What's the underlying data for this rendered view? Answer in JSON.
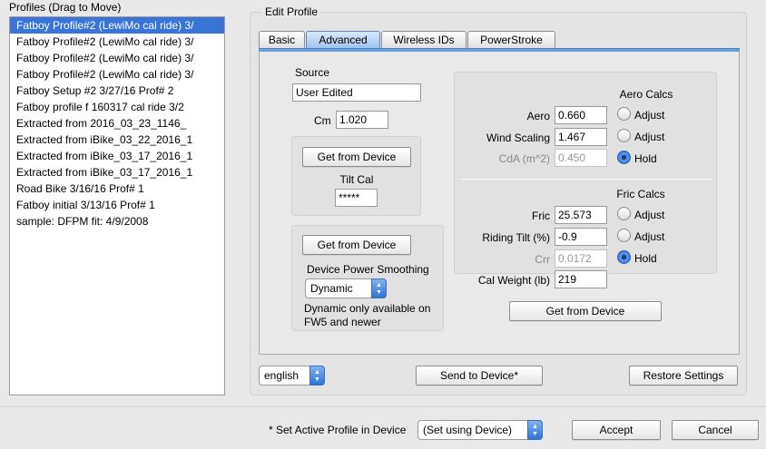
{
  "profiles": {
    "title": "Profiles (Drag to Move)",
    "items": [
      {
        "label": "Fatboy Profile#2 (LewiMo cal ride) 3/",
        "selected": true
      },
      {
        "label": "Fatboy Profile#2 (LewiMo cal ride) 3/"
      },
      {
        "label": "Fatboy Profile#2 (LewiMo cal ride) 3/"
      },
      {
        "label": "Fatboy Profile#2 (LewiMo cal ride) 3/"
      },
      {
        "label": "Fatboy Setup #2 3/27/16 Prof# 2"
      },
      {
        "label": "Fatboy profile f 160317 cal ride 3/2"
      },
      {
        "label": "Extracted from 2016_03_23_1146_"
      },
      {
        "label": "Extracted from iBike_03_22_2016_1"
      },
      {
        "label": "Extracted from iBike_03_17_2016_1"
      },
      {
        "label": "Extracted from iBike_03_17_2016_1"
      },
      {
        "label": "Road Bike 3/16/16 Prof# 1"
      },
      {
        "label": "Fatboy initial 3/13/16 Prof# 1"
      },
      {
        "label": "sample: DFPM fit: 4/9/2008"
      }
    ]
  },
  "edit": {
    "title": "Edit Profile",
    "tabs": {
      "basic": "Basic",
      "advanced": "Advanced",
      "wireless": "Wireless IDs",
      "powerstroke": "PowerStroke"
    },
    "source_label": "Source",
    "source_value": "User Edited",
    "cm_label": "Cm",
    "cm_value": "1.020",
    "get_from_device_1": "Get from Device",
    "tilt_cal_label": "Tilt Cal",
    "tilt_cal_value": "*****",
    "get_from_device_2": "Get from Device",
    "smoothing_label": "Device Power Smoothing",
    "smoothing_value": "Dynamic",
    "smoothing_note_1": "Dynamic only available on",
    "smoothing_note_2": "FW5 and newer",
    "aero_calcs_title": "Aero Calcs",
    "aero_label": "Aero",
    "aero_value": "0.660",
    "wind_label": "Wind Scaling",
    "wind_value": "1.467",
    "cda_label": "CdA (m^2)",
    "cda_value": "0.450",
    "adjust_label": "Adjust",
    "hold_label": "Hold",
    "fric_calcs_title": "Fric Calcs",
    "fric_label": "Fric",
    "fric_value": "25.573",
    "tilt_label": "Riding Tilt (%)",
    "tilt_value": "-0.9",
    "crr_label": "Crr",
    "crr_value": "0.0172",
    "calweight_label": "Cal Weight (lb)",
    "calweight_value": "219",
    "get_from_device_3": "Get from Device"
  },
  "footer": {
    "language": "english",
    "send": "Send to Device*",
    "restore": "Restore Settings",
    "active_note": "* Set Active Profile in Device",
    "active_value": "(Set using Device)",
    "accept": "Accept",
    "cancel": "Cancel"
  },
  "colors": {
    "selection": "#3875d7",
    "accent": "#2f73d4"
  }
}
